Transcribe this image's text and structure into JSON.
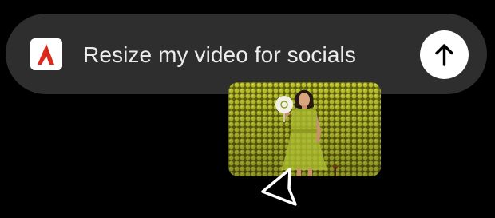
{
  "prompt": {
    "text": "Resize my video for socials",
    "app_icon": "adobe-express-logo",
    "send_icon": "arrow-up-icon"
  },
  "media": {
    "type": "video-thumbnail",
    "subject": "woman in green dress holding a fan"
  },
  "cursor": {
    "icon": "pointer-arrow-icon"
  },
  "colors": {
    "background": "#000000",
    "bar": "#2e2e2e",
    "text": "#ececec",
    "logo_red": "#e0291c",
    "thumb_bg": "#9ca21c",
    "dress": "#a5b52e"
  }
}
